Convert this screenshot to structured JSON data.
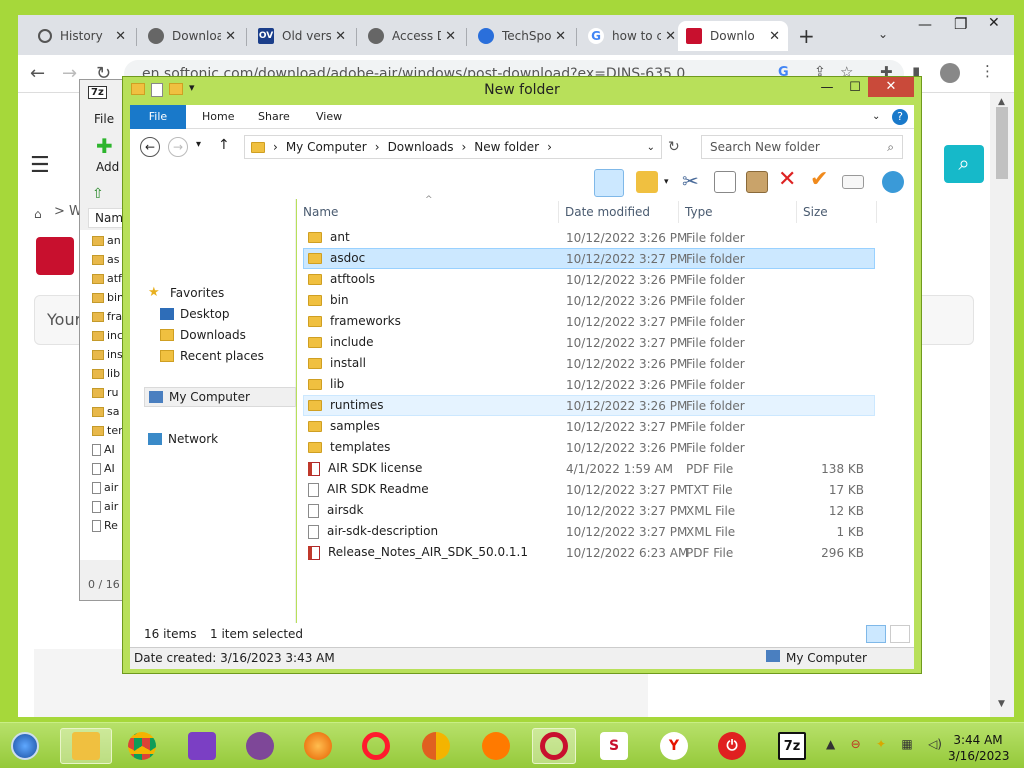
{
  "browser": {
    "tabs": [
      {
        "label": "History",
        "icon": "history-icon"
      },
      {
        "label": "Downloa",
        "icon": "globe-icon"
      },
      {
        "label": "Old vers",
        "icon": "oldversion-icon",
        "icon_text": "OV"
      },
      {
        "label": "Access D",
        "icon": "globe-icon"
      },
      {
        "label": "TechSpo",
        "icon": "techspot-icon"
      },
      {
        "label": "how to c",
        "icon": "google-icon",
        "icon_text": "G"
      },
      {
        "label": "Downlo",
        "icon": "adobe-icon",
        "active": true
      }
    ],
    "new_tab": "+",
    "url": "en.softonic.com/download/adobe-air/windows/post-download?ex=DINS-635.0",
    "page_fragments": {
      "breadcrumb": "W",
      "search_text": "Your",
      "brand_color": "#c8102e",
      "search_btn_color": "#16b9c9"
    }
  },
  "sevenzip": {
    "title_icon": "7z",
    "menu_file": "File",
    "add_label": "Add",
    "col_name": "Name",
    "items": [
      "an",
      "as",
      "atf",
      "bin",
      "fra",
      "inc",
      "ins",
      "lib",
      "ru",
      "sa",
      "ter",
      "AI",
      "AI",
      "air",
      "air",
      "Re"
    ],
    "status": "0 / 16"
  },
  "explorer": {
    "title": "New folder",
    "ribbon_tabs": [
      "File",
      "Home",
      "Share",
      "View"
    ],
    "breadcrumb": [
      "My Computer",
      "Downloads",
      "New folder"
    ],
    "search_placeholder": "Search New folder",
    "nav": {
      "favorites": "Favorites",
      "fav_items": [
        "Desktop",
        "Downloads",
        "Recent places"
      ],
      "computer": "My Computer",
      "network": "Network"
    },
    "columns": [
      "Name",
      "Date modified",
      "Type",
      "Size"
    ],
    "rows": [
      {
        "name": "ant",
        "date": "10/12/2022 3:26 PM",
        "type": "File folder",
        "size": "",
        "kind": "folder"
      },
      {
        "name": "asdoc",
        "date": "10/12/2022 3:27 PM",
        "type": "File folder",
        "size": "",
        "kind": "folder",
        "state": "selected"
      },
      {
        "name": "atftools",
        "date": "10/12/2022 3:26 PM",
        "type": "File folder",
        "size": "",
        "kind": "folder"
      },
      {
        "name": "bin",
        "date": "10/12/2022 3:26 PM",
        "type": "File folder",
        "size": "",
        "kind": "folder"
      },
      {
        "name": "frameworks",
        "date": "10/12/2022 3:27 PM",
        "type": "File folder",
        "size": "",
        "kind": "folder"
      },
      {
        "name": "include",
        "date": "10/12/2022 3:27 PM",
        "type": "File folder",
        "size": "",
        "kind": "folder"
      },
      {
        "name": "install",
        "date": "10/12/2022 3:26 PM",
        "type": "File folder",
        "size": "",
        "kind": "folder"
      },
      {
        "name": "lib",
        "date": "10/12/2022 3:26 PM",
        "type": "File folder",
        "size": "",
        "kind": "folder"
      },
      {
        "name": "runtimes",
        "date": "10/12/2022 3:26 PM",
        "type": "File folder",
        "size": "",
        "kind": "folder",
        "state": "hover"
      },
      {
        "name": "samples",
        "date": "10/12/2022 3:27 PM",
        "type": "File folder",
        "size": "",
        "kind": "folder"
      },
      {
        "name": "templates",
        "date": "10/12/2022 3:26 PM",
        "type": "File folder",
        "size": "",
        "kind": "folder"
      },
      {
        "name": "AIR SDK license",
        "date": "4/1/2022 1:59 AM",
        "type": "PDF File",
        "size": "138 KB",
        "kind": "pdf"
      },
      {
        "name": "AIR SDK Readme",
        "date": "10/12/2022 3:27 PM",
        "type": "TXT File",
        "size": "17 KB",
        "kind": "txt"
      },
      {
        "name": "airsdk",
        "date": "10/12/2022 3:27 PM",
        "type": "XML File",
        "size": "12 KB",
        "kind": "xml"
      },
      {
        "name": "air-sdk-description",
        "date": "10/12/2022 3:27 PM",
        "type": "XML File",
        "size": "1 KB",
        "kind": "xml"
      },
      {
        "name": "Release_Notes_AIR_SDK_50.0.1.1",
        "date": "10/12/2022 6:23 AM",
        "type": "PDF File",
        "size": "296 KB",
        "kind": "pdf"
      }
    ],
    "status": {
      "count": "16 items",
      "selected": "1 item selected"
    },
    "details": {
      "created": "Date created: 3/16/2023 3:43 AM",
      "location": "My Computer"
    }
  },
  "taskbar": {
    "apps": [
      "start-orb",
      "file-explorer",
      "chrome",
      "visual-studio",
      "tor-browser",
      "firefox",
      "opera",
      "chrome-canary",
      "uc-browser",
      "opera-gx",
      "softonic",
      "yandex",
      "power-app",
      "7zip"
    ],
    "sevenzip_label": "7z",
    "time": "3:44 AM",
    "date": "3/16/2023"
  }
}
